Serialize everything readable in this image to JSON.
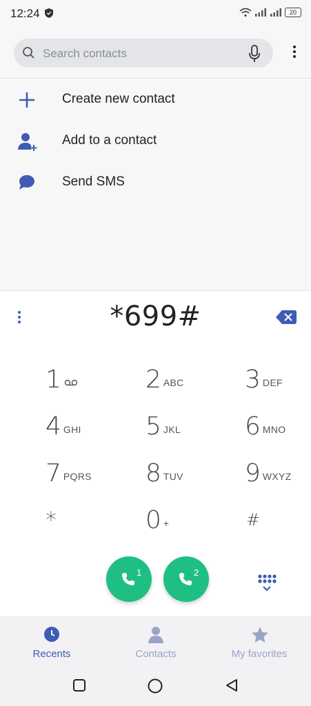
{
  "status_bar": {
    "time": "12:24",
    "battery": "20"
  },
  "search": {
    "placeholder": "Search contacts"
  },
  "actions": [
    {
      "label": "Create new contact",
      "icon": "plus-icon"
    },
    {
      "label": "Add to a contact",
      "icon": "add-person-icon"
    },
    {
      "label": "Send SMS",
      "icon": "message-bubble-icon"
    }
  ],
  "dialer": {
    "number": "*699#"
  },
  "keys": [
    {
      "digit": "1",
      "letters": ""
    },
    {
      "digit": "2",
      "letters": "ABC"
    },
    {
      "digit": "3",
      "letters": "DEF"
    },
    {
      "digit": "4",
      "letters": "GHI"
    },
    {
      "digit": "5",
      "letters": "JKL"
    },
    {
      "digit": "6",
      "letters": "MNO"
    },
    {
      "digit": "7",
      "letters": "PQRS"
    },
    {
      "digit": "8",
      "letters": "TUV"
    },
    {
      "digit": "9",
      "letters": "WXYZ"
    },
    {
      "digit": "*",
      "letters": ""
    },
    {
      "digit": "0",
      "letters": "+"
    },
    {
      "digit": "#",
      "letters": ""
    }
  ],
  "call_buttons": [
    {
      "sim": "1"
    },
    {
      "sim": "2"
    }
  ],
  "bottom_nav": [
    {
      "label": "Recents",
      "icon": "clock-icon",
      "active": true
    },
    {
      "label": "Contacts",
      "icon": "person-icon",
      "active": false
    },
    {
      "label": "My favorites",
      "icon": "star-icon",
      "active": false
    }
  ],
  "colors": {
    "accent": "#3f5bb5",
    "call_green": "#1fbf83",
    "nav_inactive": "#9aa4c9"
  }
}
